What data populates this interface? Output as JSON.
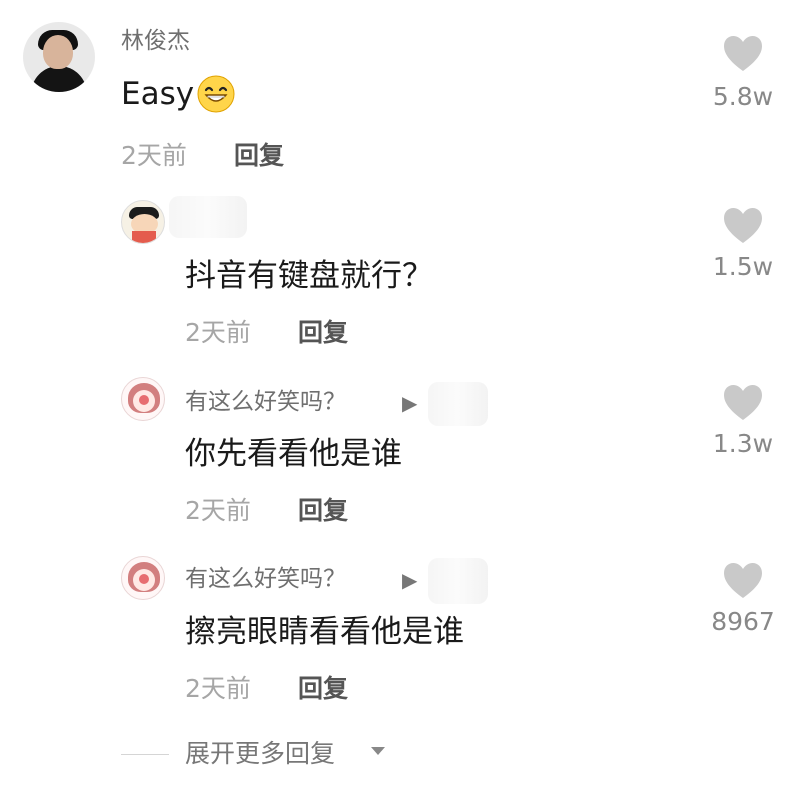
{
  "comments": [
    {
      "username": "林俊杰",
      "content": "Easy",
      "emoji": "grin-emoji",
      "time": "2天前",
      "reply_label": "回复",
      "likes": "5.8w",
      "icon": "heart-icon"
    },
    {
      "username": "",
      "content": "抖音有键盘就行？",
      "time": "2天前",
      "reply_label": "回复",
      "likes": "1.5w",
      "icon": "heart-icon"
    },
    {
      "username": "有这么好笑吗？",
      "reply_arrow": "▶",
      "content": "你先看看他是谁",
      "time": "2天前",
      "reply_label": "回复",
      "likes": "1.3w",
      "icon": "heart-icon"
    },
    {
      "username": "有这么好笑吗？",
      "reply_arrow": "▶",
      "content": "擦亮眼睛看看他是谁",
      "time": "2天前",
      "reply_label": "回复",
      "likes": "8967",
      "icon": "heart-icon"
    }
  ],
  "expand_more": {
    "label": "展开更多回复",
    "icon": "triangle-down-icon"
  },
  "colors": {
    "heart": "#c9c9c9",
    "meta": "#a6a6a6",
    "text": "#1a1a1a"
  }
}
